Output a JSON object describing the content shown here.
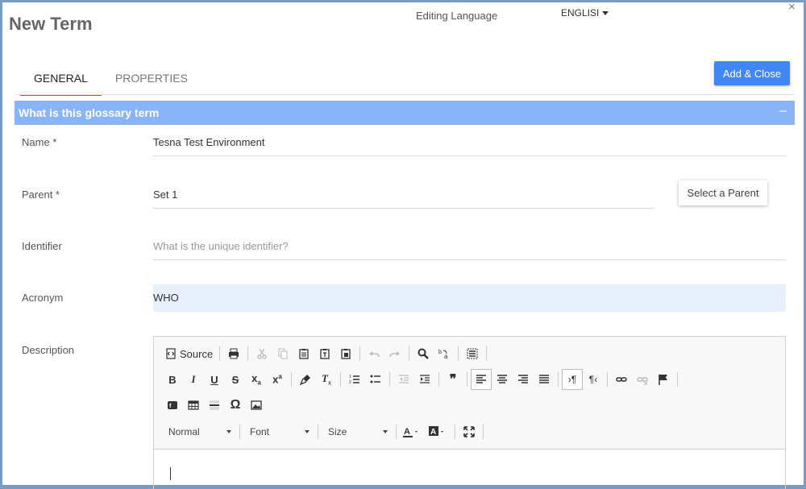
{
  "window": {
    "title": "New Term",
    "close_glyph": "×"
  },
  "language": {
    "label": "Editing Language",
    "value": "ENGLISI"
  },
  "tabs": [
    {
      "label": "GENERAL",
      "active": true
    },
    {
      "label": "PROPERTIES",
      "active": false
    }
  ],
  "actions": {
    "add_close": "Add & Close",
    "select_parent": "Select a Parent"
  },
  "section": {
    "title": "What is this glossary term",
    "collapse_glyph": "–"
  },
  "fields": {
    "name": {
      "label": "Name *",
      "value": "Tesna Test Environment"
    },
    "parent": {
      "label": "Parent  *",
      "value": "Set 1"
    },
    "identifier": {
      "label": "Identifier",
      "value": "",
      "placeholder": "What is the unique identifier?"
    },
    "acronym": {
      "label": "Acronym",
      "value": "WHO"
    },
    "description": {
      "label": "Description",
      "value": ""
    }
  },
  "editor": {
    "source_label": "Source",
    "format_value": "Normal",
    "font_value": "Font",
    "size_value": "Size",
    "icons_row1": [
      "source-icon",
      "print-icon",
      "cut-icon",
      "copy-icon",
      "paste-icon",
      "paste-text-icon",
      "paste-word-icon",
      "undo-icon",
      "redo-icon",
      "find-icon",
      "replace-icon",
      "select-all-icon"
    ],
    "icons_row2": [
      "bold-icon",
      "italic-icon",
      "underline-icon",
      "strike-icon",
      "subscript-icon",
      "superscript-icon",
      "copy-format-icon",
      "remove-format-icon",
      "numbered-list-icon",
      "bulleted-list-icon",
      "outdent-icon",
      "indent-icon",
      "blockquote-icon",
      "align-left-icon",
      "align-center-icon",
      "align-right-icon",
      "justify-icon",
      "ltr-icon",
      "rtl-icon",
      "link-icon",
      "unlink-icon",
      "anchor-icon"
    ],
    "icons_row3": [
      "flash-icon",
      "table-icon",
      "horizontal-line-icon",
      "special-char-icon",
      "image-icon"
    ],
    "icons_row4": [
      "text-color-icon",
      "background-color-icon",
      "maximize-icon"
    ]
  },
  "colors": {
    "accent": "#4285f4",
    "section_bar": "#8ab4f8",
    "acronym_highlight": "#e8f0fe",
    "frame": "#7b9ac4"
  }
}
